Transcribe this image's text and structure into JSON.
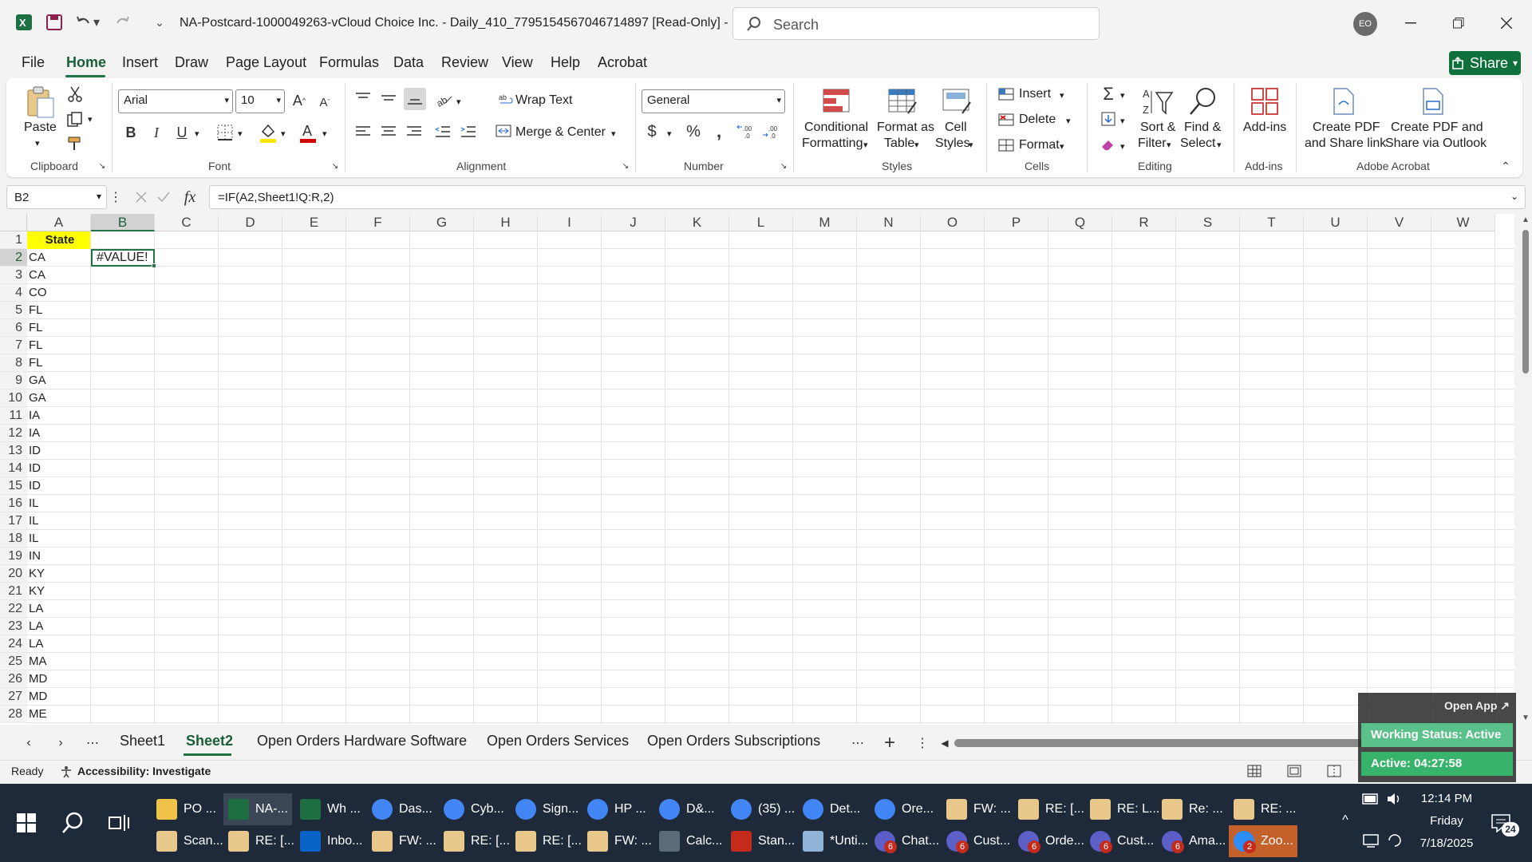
{
  "titlebar": {
    "doc_title": "NA-Postcard-1000049263-vCloud Choice Inc. - Daily_410_7795154567046714897  [Read-Only]  -  E...",
    "search_placeholder": "Search",
    "avatar_initials": "EO"
  },
  "menu": {
    "items": [
      "File",
      "Home",
      "Insert",
      "Draw",
      "Page Layout",
      "Formulas",
      "Data",
      "Review",
      "View",
      "Help",
      "Acrobat"
    ],
    "share": "Share"
  },
  "ribbon": {
    "clipboard": {
      "paste": "Paste",
      "label": "Clipboard"
    },
    "font": {
      "name": "Arial",
      "size": "10",
      "label": "Font",
      "bold": "B",
      "italic": "I",
      "underline": "U"
    },
    "alignment": {
      "wrap": "Wrap Text",
      "merge": "Merge & Center",
      "label": "Alignment"
    },
    "number": {
      "format": "General",
      "label": "Number"
    },
    "styles": {
      "conditional_1": "Conditional",
      "conditional_2": "Formatting",
      "table_1": "Format as",
      "table_2": "Table",
      "cell_1": "Cell",
      "cell_2": "Styles",
      "label": "Styles"
    },
    "cells": {
      "insert": "Insert",
      "delete": "Delete",
      "format": "Format",
      "label": "Cells"
    },
    "editing": {
      "sort_1": "Sort &",
      "sort_2": "Filter",
      "find_1": "Find &",
      "find_2": "Select",
      "label": "Editing"
    },
    "addins": {
      "btn": "Add-ins",
      "label": "Add-ins"
    },
    "acrobat": {
      "pdf1_1": "Create PDF",
      "pdf1_2": "and Share link",
      "pdf2_1": "Create PDF and",
      "pdf2_2": "Share via Outlook",
      "label": "Adobe Acrobat"
    }
  },
  "formula_bar": {
    "cell_ref": "B2",
    "formula": "=IF(A2,Sheet1!Q:R,2)"
  },
  "grid": {
    "columns": [
      "A",
      "B",
      "C",
      "D",
      "E",
      "F",
      "G",
      "H",
      "I",
      "J",
      "K",
      "L",
      "M",
      "N",
      "O",
      "P",
      "Q",
      "R",
      "S",
      "T",
      "U",
      "V",
      "W"
    ],
    "header_cell": "State",
    "states": [
      "CA",
      "CA",
      "CO",
      "FL",
      "FL",
      "FL",
      "FL",
      "GA",
      "GA",
      "IA",
      "IA",
      "ID",
      "ID",
      "ID",
      "IL",
      "IL",
      "IL",
      "IN",
      "KY",
      "KY",
      "LA",
      "LA",
      "LA",
      "MA",
      "MD",
      "MD",
      "ME"
    ],
    "b2_value": "#VALUE!"
  },
  "sheet_tabs": [
    "Sheet1",
    "Sheet2",
    "Open Orders Hardware Software",
    "Open Orders Services",
    "Open Orders Subscriptions"
  ],
  "status": {
    "ready": "Ready",
    "accessibility": "Accessibility: Investigate"
  },
  "overlay": {
    "open_app": "Open App ↗",
    "working": "Working Status: Active",
    "active": "Active: 04:27:58"
  },
  "taskbar": {
    "row1": [
      "PO ...",
      "NA-...",
      "Wh ...",
      "Das...",
      "Cyb...",
      "Sign...",
      "HP ...",
      "D&...",
      "(35) ...",
      "Det...",
      "Ore...",
      "FW: ...",
      "RE: [...",
      "RE: L...",
      "Re: ...",
      "RE: ..."
    ],
    "row2": [
      "Scan...",
      "RE: [...",
      "Inbo...",
      "FW: ...",
      "RE: [...",
      "RE: [...",
      "FW: ...",
      "Calc...",
      "Stan...",
      "*Unti...",
      "Chat...",
      "Cust...",
      "Orde...",
      "Cust...",
      "Ama...",
      "Zoo..."
    ],
    "time": "12:14 PM",
    "day": "Friday",
    "date": "7/18/2025",
    "notif_count": "24"
  }
}
